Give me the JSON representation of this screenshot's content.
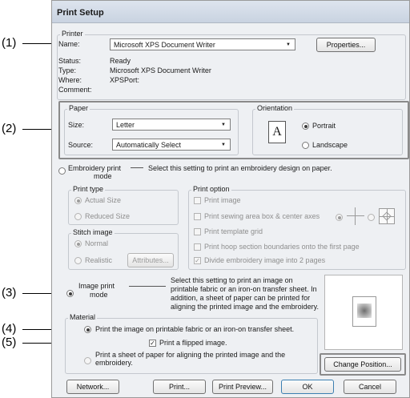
{
  "callouts": {
    "c1": "(1)",
    "c2": "(2)",
    "c3": "(3)",
    "c4": "(4)",
    "c5": "(5)"
  },
  "dialog": {
    "title": "Print Setup"
  },
  "printer": {
    "group_label": "Printer",
    "name_label": "Name:",
    "name_value": "Microsoft XPS Document Writer",
    "properties_button": "Properties...",
    "status_label": "Status:",
    "status_value": "Ready",
    "type_label": "Type:",
    "type_value": "Microsoft XPS Document Writer",
    "where_label": "Where:",
    "where_value": "XPSPort:",
    "comment_label": "Comment:",
    "comment_value": ""
  },
  "paper": {
    "group_label": "Paper",
    "size_label": "Size:",
    "size_value": "Letter",
    "source_label": "Source:",
    "source_value": "Automatically Select"
  },
  "orientation": {
    "group_label": "Orientation",
    "icon_letter": "A",
    "portrait": "Portrait",
    "landscape": "Landscape"
  },
  "embroidery": {
    "mode_label_1": "Embroidery print",
    "mode_label_2": "mode",
    "description": "Select this setting to print an embroidery design on paper.",
    "print_type_label": "Print type",
    "actual_size": "Actual Size",
    "reduced_size": "Reduced Size",
    "stitch_image_label": "Stitch image",
    "normal": "Normal",
    "realistic": "Realistic",
    "attributes_button": "Attributes...",
    "print_option_label": "Print option",
    "opt_print_image": "Print image",
    "opt_sewing_area": "Print sewing area box & center axes",
    "opt_template_grid": "Print template grid",
    "opt_hoop_boundaries": "Print hoop section boundaries onto the first page",
    "opt_divide": "Divide embroidery image into 2 pages"
  },
  "image_mode": {
    "mode_label_1": "Image print",
    "mode_label_2": "mode",
    "description_lines": [
      "Select this setting to print an image on",
      "printable fabric or an iron-on transfer sheet. In",
      "addition, a sheet of paper can be printed for",
      "aligning the printed image and the embroidery."
    ],
    "material_label": "Material",
    "opt_printable_fabric": "Print the image on printable fabric or an iron-on transfer sheet.",
    "opt_flipped": "Print a flipped image.",
    "opt_align_sheet_1": "Print a sheet of paper for aligning the printed image and the",
    "opt_align_sheet_2": "embroidery.",
    "change_position_button": "Change Position..."
  },
  "footer": {
    "network": "Network...",
    "print": "Print...",
    "print_preview": "Print Preview...",
    "ok": "OK",
    "cancel": "Cancel"
  }
}
